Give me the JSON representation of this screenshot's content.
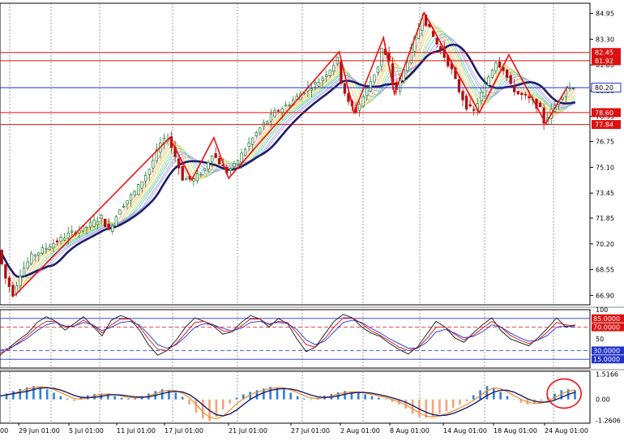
{
  "chart_data": [
    {
      "type": "candlestick",
      "title": "",
      "ylim": [
        66.3,
        85.6
      ],
      "y_ticks": [
        "84.95",
        "83.30",
        "81.65",
        "80.00",
        "78.35",
        "76.75",
        "75.10",
        "73.45",
        "71.85",
        "70.20",
        "68.55",
        "66.90"
      ],
      "x_ticks": [
        "29 Jun 01:00",
        "5 Jul 01:00",
        "11 Jul 01:00",
        "17 Jul 01:00",
        "21 Jul 01:00",
        "27 Jul 01:00",
        "2 Aug 01:00",
        "8 Aug 01:00",
        "14 Aug 01:00",
        "18 Aug 01:00",
        "24 Aug 01:00"
      ],
      "x_ticks_partial_left": "00",
      "price_path": [
        {
          "x": 0,
          "y": 69.8
        },
        {
          "x": 2,
          "y": 68.0
        },
        {
          "x": 4,
          "y": 67.0
        },
        {
          "x": 6,
          "y": 68.3
        },
        {
          "x": 9,
          "y": 69.4
        },
        {
          "x": 14,
          "y": 70.1
        },
        {
          "x": 19,
          "y": 70.8
        },
        {
          "x": 24,
          "y": 71.3
        },
        {
          "x": 28,
          "y": 71.9
        },
        {
          "x": 30,
          "y": 71.0
        },
        {
          "x": 33,
          "y": 72.5
        },
        {
          "x": 37,
          "y": 73.5
        },
        {
          "x": 41,
          "y": 75.0
        },
        {
          "x": 44,
          "y": 76.6
        },
        {
          "x": 46,
          "y": 77.0
        },
        {
          "x": 48,
          "y": 75.8
        },
        {
          "x": 50,
          "y": 74.4
        },
        {
          "x": 53,
          "y": 74.3
        },
        {
          "x": 56,
          "y": 75.0
        },
        {
          "x": 58,
          "y": 76.0
        },
        {
          "x": 60,
          "y": 75.4
        },
        {
          "x": 62,
          "y": 74.8
        },
        {
          "x": 64,
          "y": 75.2
        },
        {
          "x": 67,
          "y": 76.3
        },
        {
          "x": 71,
          "y": 77.6
        },
        {
          "x": 75,
          "y": 78.6
        },
        {
          "x": 79,
          "y": 79.2
        },
        {
          "x": 83,
          "y": 80.0
        },
        {
          "x": 87,
          "y": 80.6
        },
        {
          "x": 90,
          "y": 81.4
        },
        {
          "x": 92,
          "y": 82.0
        },
        {
          "x": 93,
          "y": 80.6
        },
        {
          "x": 95,
          "y": 79.2
        },
        {
          "x": 97,
          "y": 78.7
        },
        {
          "x": 99,
          "y": 79.6
        },
        {
          "x": 101,
          "y": 80.6
        },
        {
          "x": 103,
          "y": 81.6
        },
        {
          "x": 104,
          "y": 82.7
        },
        {
          "x": 106,
          "y": 81.8
        },
        {
          "x": 107,
          "y": 80.4
        },
        {
          "x": 108,
          "y": 80.1
        },
        {
          "x": 110,
          "y": 81.3
        },
        {
          "x": 112,
          "y": 82.6
        },
        {
          "x": 114,
          "y": 84.0
        },
        {
          "x": 115,
          "y": 84.8
        },
        {
          "x": 117,
          "y": 83.9
        },
        {
          "x": 119,
          "y": 83.0
        },
        {
          "x": 121,
          "y": 82.2
        },
        {
          "x": 123,
          "y": 81.3
        },
        {
          "x": 125,
          "y": 80.0
        },
        {
          "x": 127,
          "y": 79.0
        },
        {
          "x": 129,
          "y": 78.7
        },
        {
          "x": 131,
          "y": 79.8
        },
        {
          "x": 133,
          "y": 80.9
        },
        {
          "x": 135,
          "y": 81.9
        },
        {
          "x": 137,
          "y": 81.4
        },
        {
          "x": 139,
          "y": 80.3
        },
        {
          "x": 141,
          "y": 79.8
        },
        {
          "x": 143,
          "y": 79.6
        },
        {
          "x": 145,
          "y": 79.3
        },
        {
          "x": 147,
          "y": 78.8
        },
        {
          "x": 148,
          "y": 78.0
        },
        {
          "x": 150,
          "y": 78.7
        },
        {
          "x": 152,
          "y": 79.4
        },
        {
          "x": 154,
          "y": 80.1
        },
        {
          "x": 156,
          "y": 80.3
        }
      ],
      "zigzag": [
        {
          "x": 4,
          "y": 66.9
        },
        {
          "x": 46,
          "y": 77.0
        },
        {
          "x": 52,
          "y": 74.3
        },
        {
          "x": 58,
          "y": 77.0
        },
        {
          "x": 62,
          "y": 74.4
        },
        {
          "x": 92,
          "y": 82.5
        },
        {
          "x": 96,
          "y": 78.6
        },
        {
          "x": 104,
          "y": 83.4
        },
        {
          "x": 107,
          "y": 79.8
        },
        {
          "x": 115,
          "y": 85.0
        },
        {
          "x": 130,
          "y": 78.6
        },
        {
          "x": 138,
          "y": 82.3
        },
        {
          "x": 148,
          "y": 77.9
        },
        {
          "x": 154,
          "y": 80.3
        }
      ],
      "horizontal_levels": [
        {
          "value": "82.45",
          "color": "#dd1111"
        },
        {
          "value": "81.92",
          "color": "#dd1111"
        },
        {
          "value": "80.20",
          "color": "#2233cc"
        },
        {
          "value": "78.60",
          "color": "#dd1111"
        },
        {
          "value": "77.84",
          "color": "#dd1111"
        }
      ],
      "moving_average_ribbon": true,
      "last_price": "80.20",
      "grid": "vertical dashed",
      "colors": {
        "bull": "#1b7a2b",
        "bear": "#b01010",
        "ma_long": "#1c1c6b",
        "zigzag": "#ee1111",
        "level": "#dd1111",
        "current": "#2233cc"
      }
    },
    {
      "type": "line",
      "name": "stochastic",
      "ylim": [
        0,
        100
      ],
      "y_ticks": [
        "100",
        "85.0000",
        "70.0000",
        "50",
        "30.0000",
        "15.0000"
      ],
      "levels": [
        85,
        70,
        30,
        15
      ],
      "series": [
        {
          "color": "#111111",
          "values": [
            22,
            35,
            48,
            60,
            78,
            88,
            80,
            65,
            76,
            88,
            72,
            55,
            82,
            90,
            84,
            66,
            40,
            22,
            30,
            48,
            70,
            86,
            80,
            72,
            58,
            62,
            78,
            90,
            84,
            70,
            85,
            76,
            50,
            28,
            36,
            58,
            80,
            92,
            86,
            70,
            60,
            54,
            42,
            32,
            24,
            36,
            58,
            80,
            70,
            52,
            44,
            60,
            74,
            86,
            64,
            50,
            44,
            38,
            52,
            68,
            86,
            70,
            74
          ]
        },
        {
          "color": "#cc1111",
          "values": [
            26,
            32,
            44,
            56,
            70,
            80,
            80,
            70,
            72,
            82,
            74,
            60,
            74,
            84,
            84,
            72,
            50,
            32,
            30,
            42,
            60,
            78,
            80,
            74,
            64,
            62,
            72,
            84,
            84,
            74,
            80,
            78,
            60,
            40,
            36,
            50,
            70,
            86,
            86,
            76,
            64,
            56,
            46,
            36,
            30,
            34,
            50,
            70,
            70,
            58,
            48,
            56,
            68,
            80,
            70,
            56,
            48,
            42,
            48,
            62,
            78,
            74,
            72
          ]
        },
        {
          "color": "#2233cc",
          "values": [
            30,
            34,
            42,
            52,
            64,
            74,
            78,
            72,
            72,
            78,
            74,
            64,
            70,
            78,
            80,
            74,
            58,
            40,
            34,
            40,
            54,
            70,
            76,
            74,
            68,
            64,
            68,
            78,
            80,
            76,
            78,
            76,
            66,
            48,
            40,
            46,
            62,
            78,
            82,
            78,
            68,
            60,
            50,
            42,
            34,
            34,
            44,
            62,
            66,
            60,
            52,
            54,
            62,
            74,
            70,
            60,
            52,
            46,
            48,
            56,
            70,
            72,
            70
          ]
        }
      ]
    },
    {
      "type": "bar",
      "name": "histogram-oscillator",
      "ylim": [
        -1.42,
        1.68
      ],
      "y_ticks": [
        "1.5166",
        "0.00",
        "-1.2606"
      ],
      "values": [
        0.2,
        0.35,
        0.5,
        0.62,
        0.72,
        0.8,
        0.75,
        0.6,
        0.4,
        0.2,
        0.05,
        -0.1,
        0.1,
        0.25,
        0.32,
        0.35,
        0.3,
        0.2,
        0.1,
        0.05,
        0.1,
        0.2,
        0.35,
        0.5,
        0.6,
        0.55,
        0.4,
        0.15,
        -0.3,
        -0.8,
        -1.15,
        -1.3,
        -1.05,
        -0.6,
        -0.25,
        0.1,
        0.3,
        0.45,
        0.55,
        0.65,
        0.75,
        0.7,
        0.6,
        0.4,
        0.2,
        0.05,
        0.0,
        0.1,
        0.22,
        0.32,
        0.42,
        0.5,
        0.45,
        0.38,
        0.3,
        0.2,
        0.1,
        0.0,
        -0.15,
        -0.3,
        -0.55,
        -0.85,
        -1.05,
        -1.1,
        -1.0,
        -0.85,
        -0.7,
        -0.5,
        -0.3,
        -0.1,
        0.25,
        0.55,
        0.8,
        0.7,
        0.45,
        0.2,
        0.0,
        -0.2,
        -0.3,
        -0.25,
        -0.1,
        0.1,
        0.35,
        0.55,
        0.6,
        0.55
      ],
      "colors": {
        "positive": "#2f7fd6",
        "negative": "#f4a27a",
        "line1": "#ee8a22",
        "line2": "#1c1c6b",
        "highlight": "#ee1111"
      }
    }
  ]
}
